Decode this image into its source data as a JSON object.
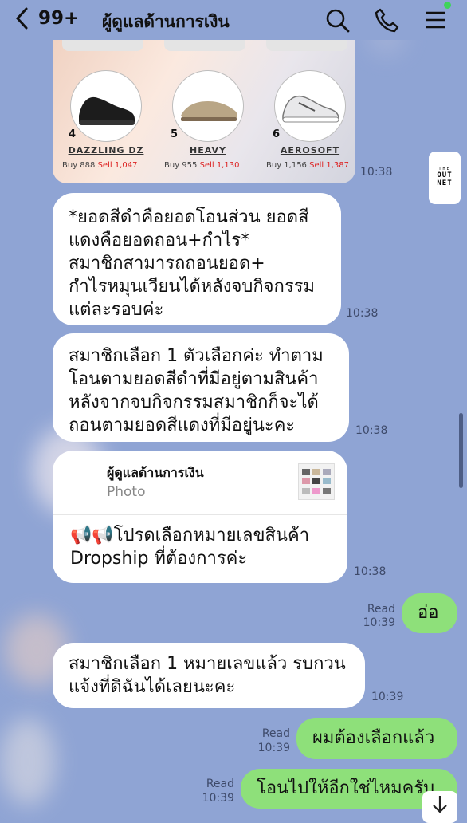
{
  "header": {
    "unread_count": "99+",
    "chat_title": "ผู้ดูแลด้านการเงิน"
  },
  "products": [
    {
      "number": "4",
      "name": "DAZZLING DZ",
      "buy": "Buy 888",
      "sell": "Sell 1,047"
    },
    {
      "number": "5",
      "name": "HEAVY",
      "buy": "Buy 955",
      "sell": "Sell 1,130"
    },
    {
      "number": "6",
      "name": "AEROSOFT",
      "buy": "Buy 1,156",
      "sell": "Sell 1,387"
    }
  ],
  "messages": {
    "image_time": "10:38",
    "m1_lines": [
      "*ยอดสีดำคือยอดโอนส่วน ยอดสี",
      "แดงคือยอดถอน+กำไร*",
      "สมาชิกสามารถถอนยอด+",
      "กำไรหมุนเวียนได้หลังจบกิจกรรม",
      "แต่ละรอบค่ะ"
    ],
    "m1_time": "10:38",
    "m2_lines": [
      "สมาชิกเลือก 1 ตัวเลือกค่ะ ทำตาม",
      "โอนตามยอดสีดำที่มีอยู่ตามสินค้า",
      "หลังจากจบกิจกรรมสมาชิกก็จะได้",
      "ถอนตามยอดสีแดงที่มีอยู่นะคะ"
    ],
    "m2_time": "10:38",
    "reply_name": "ผู้ดูแลด้านการเงิน",
    "reply_type": "Photo",
    "m3_emoji": "📢📢",
    "m3_lines": [
      "โปรดเลือกหมายเลขสินค้า",
      "Dropship ที่ต้องการค่ะ"
    ],
    "m3_time": "10:38",
    "s1_text": "อ่อ",
    "s1_read": "Read",
    "s1_time": "10:39",
    "m4_lines": [
      "สมาชิกเลือก 1 หมายเลขแล้ว รบกวน",
      "แจ้งที่ดิฉันได้เลยนะคะ"
    ],
    "m4_time": "10:39",
    "s2_text": "ผมต้องเลือกแล้ว",
    "s2_read": "Read",
    "s2_time": "10:39",
    "s3_text": "โอนไปให้อีกใช่ไหมครับ",
    "s3_read": "Read",
    "s3_time": "10:39"
  },
  "ad": {
    "line1": "THE",
    "line2": "OUT",
    "line3": "NET"
  },
  "colors": {
    "background": "#8fa4d4",
    "sent_bubble": "#8ee07a",
    "sell_price": "#dd2222"
  }
}
